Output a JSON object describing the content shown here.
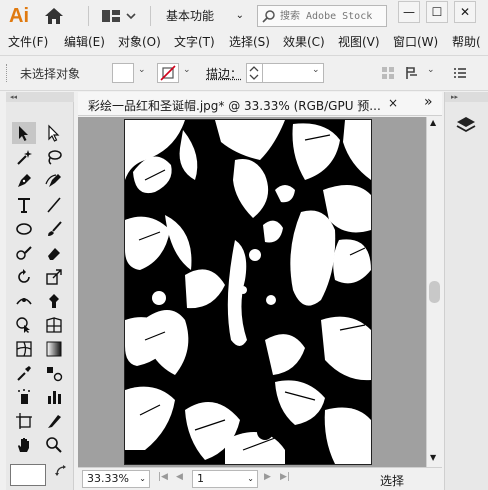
{
  "app": {
    "logo": "Ai",
    "workspace": "基本功能",
    "search_placeholder": "搜索 Adobe Stock",
    "window_controls": {
      "minimize": "—",
      "maximize": "☐",
      "close": "✕"
    }
  },
  "menubar": {
    "items": [
      {
        "label": "文件(F)"
      },
      {
        "label": "编辑(E)"
      },
      {
        "label": "对象(O)"
      },
      {
        "label": "文字(T)"
      },
      {
        "label": "选择(S)"
      },
      {
        "label": "效果(C)"
      },
      {
        "label": "视图(V)"
      },
      {
        "label": "窗口(W)"
      },
      {
        "label": "帮助("
      }
    ]
  },
  "controlbar": {
    "selection_status": "未选择对象",
    "stroke_label": "描边："
  },
  "document": {
    "tab_title": "彩绘一品红和圣诞帽.jpg* @ 33.33% (RGB/GPU 预...",
    "close": "×",
    "more": "»"
  },
  "statusbar": {
    "zoom": "33.33%",
    "page": "1",
    "status": "选择",
    "nav_first": "|◀",
    "nav_prev": "◀",
    "nav_next": "▶",
    "nav_last": "▶|"
  },
  "colors": {
    "accent": "#e07a10",
    "canvas_bg": "#a0a0a0",
    "artwork_dark": "#000000",
    "artwork_light": "#ffffff",
    "stroke_none": "#d0021b"
  },
  "icons": [
    "home-icon",
    "arrange-documents-icon",
    "search-icon",
    "selection-tool-icon",
    "direct-selection-tool-icon",
    "magic-wand-icon",
    "lasso-icon",
    "pen-icon",
    "curvature-icon",
    "type-icon",
    "line-tool-icon",
    "ellipse-icon",
    "paintbrush-icon",
    "shaper-icon",
    "eraser-icon",
    "rotate-icon",
    "scale-icon",
    "width-tool-icon",
    "puppet-warp-icon",
    "shape-builder-icon",
    "perspective-grid-icon",
    "mesh-icon",
    "gradient-icon",
    "eyedropper-icon",
    "blend-icon",
    "symbol-sprayer-icon",
    "column-graph-icon",
    "artboard-icon",
    "slice-icon",
    "hand-icon",
    "zoom-icon",
    "layers-icon"
  ]
}
